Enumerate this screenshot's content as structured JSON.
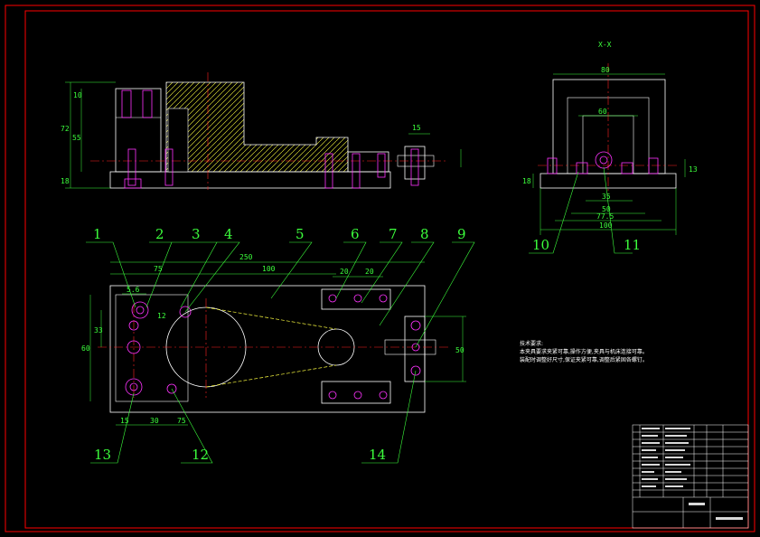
{
  "colors": {
    "background": "#000000",
    "border": "#ff0000",
    "outline": "#ffffff",
    "dimension": "#3cff3c",
    "center_line": "#ff2020",
    "hidden": "#ffff40",
    "fastener": "#ff33ff",
    "hatch": "#ffff40"
  },
  "front_view": {
    "dims": [
      "10",
      "72",
      "55",
      "18",
      "15"
    ]
  },
  "side_view": {
    "title": "X-X",
    "dims": [
      "80",
      "60",
      "35",
      "50",
      "77.5",
      "100",
      "13",
      "18"
    ]
  },
  "plan_view": {
    "dims": [
      "250",
      "75",
      "100",
      "20",
      "20",
      "5.6",
      "12",
      "33",
      "60",
      "15",
      "30",
      "75",
      "50"
    ]
  },
  "part_labels": [
    "1",
    "2",
    "3",
    "4",
    "5",
    "6",
    "7",
    "8",
    "9",
    "10",
    "11",
    "12",
    "13",
    "14"
  ],
  "notes": {
    "title": "技术要求:",
    "line1": "本夹具要求夹紧可靠,操作方便,夹具与机床连接可靠。",
    "line2": "装配时调整好尺寸,保证夹紧可靠,调整后紧固各螺钉。"
  }
}
